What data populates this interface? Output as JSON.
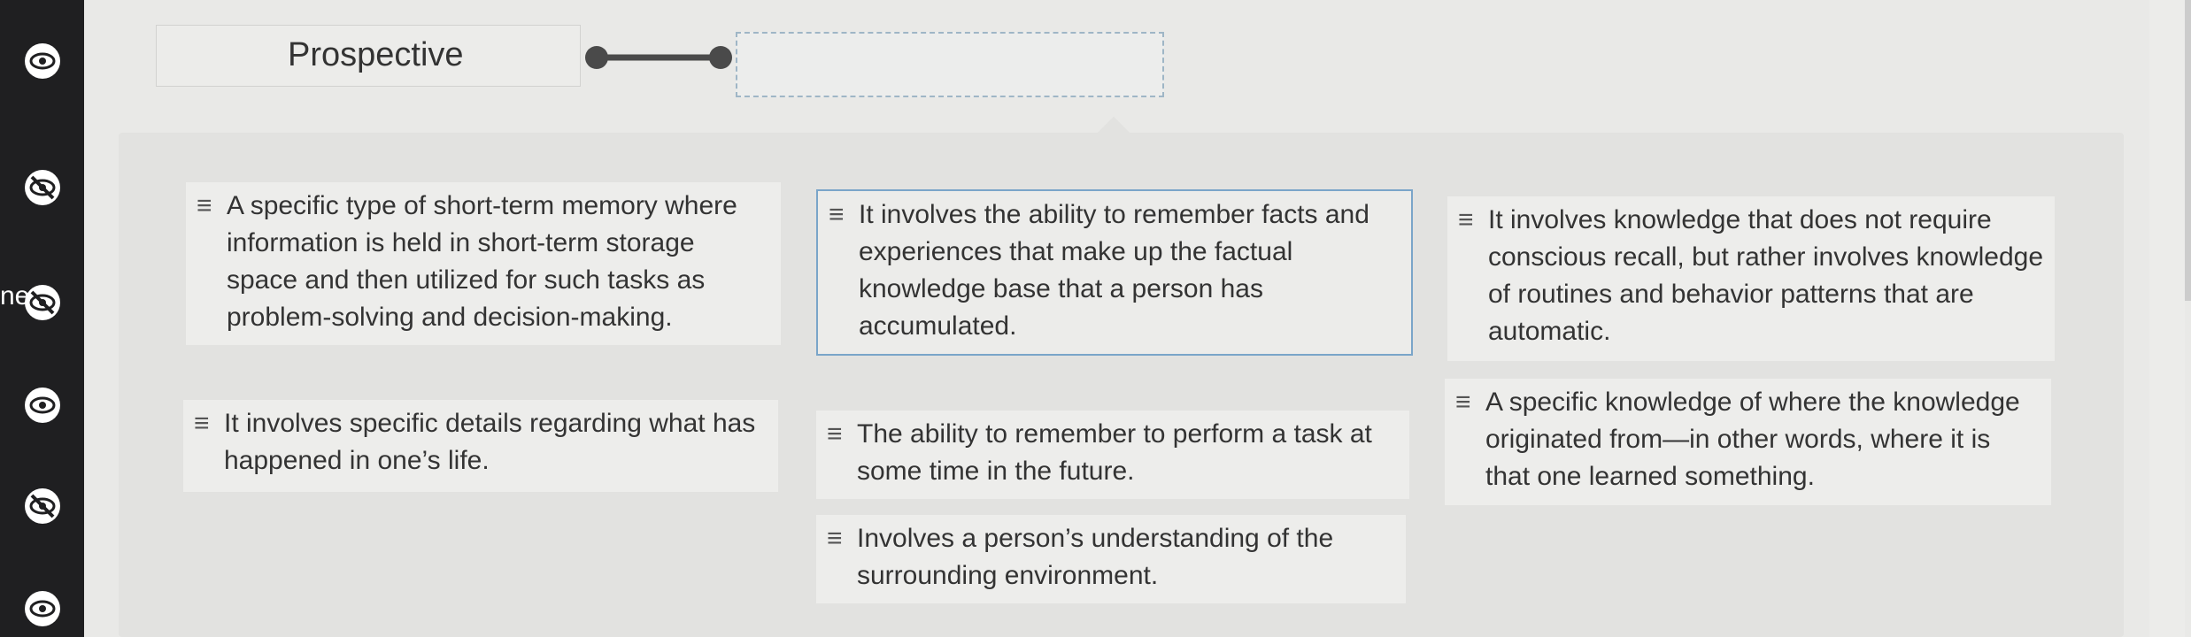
{
  "sidebar": {
    "text_fragment": "ne",
    "icons": [
      "eye-icon",
      "eye-slash-icon",
      "eye-slash-icon",
      "eye-icon",
      "eye-slash-icon",
      "eye-icon"
    ]
  },
  "match": {
    "term": "Prospective",
    "target_value": ""
  },
  "cards": [
    {
      "text": "A specific type of short-term memory where information is held in short-term storage space and then utilized for such tasks as problem-solving and decision-making."
    },
    {
      "text": "It involves the ability to remember facts and experiences that make up the factual knowledge base that a person has accumulated."
    },
    {
      "text": "It involves knowledge that does not require conscious recall, but rather involves knowledge of routines and behavior patterns that are automatic."
    },
    {
      "text": "It involves specific details regarding what has happened in one’s life."
    },
    {
      "text": "The ability to remember to perform a task at some time in the future."
    },
    {
      "text": "A specific knowledge of where the knowledge originated from—in other words, where it is that one learned something."
    },
    {
      "text": "Involves a person’s understanding of the surrounding environment."
    }
  ],
  "colors": {
    "sidebar_bg": "#1f1f21",
    "selected_border": "#7aa5c9",
    "connector": "#4a4a4a"
  }
}
